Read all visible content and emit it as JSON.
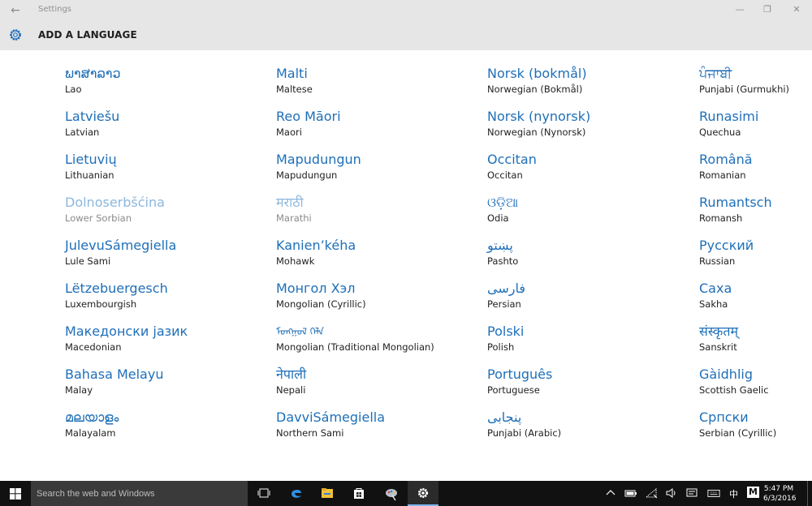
{
  "window": {
    "title": "Settings",
    "back_glyph": "←",
    "minimize_glyph": "—",
    "restore_glyph": "❐",
    "close_glyph": "✕"
  },
  "header": {
    "title": "ADD A LANGUAGE",
    "icon": "gear-icon"
  },
  "languages": {
    "columns": [
      [
        {
          "native": "ພາສາລາວ",
          "english": "Lao"
        },
        {
          "native": "Latviešu",
          "english": "Latvian"
        },
        {
          "native": "Lietuvių",
          "english": "Lithuanian"
        },
        {
          "native": "Dolnoserbšćina",
          "english": "Lower Sorbian"
        },
        {
          "native": "JulevuSámegiella",
          "english": "Lule Sami"
        },
        {
          "native": "Lëtzebuergesch",
          "english": "Luxembourgish"
        },
        {
          "native": "Македонски јазик",
          "english": "Macedonian"
        },
        {
          "native": "Bahasa Melayu",
          "english": "Malay"
        },
        {
          "native": "മലയാളം",
          "english": "Malayalam"
        }
      ],
      [
        {
          "native": "Malti",
          "english": "Maltese"
        },
        {
          "native": "Reo Māori",
          "english": "Maori"
        },
        {
          "native": "Mapudungun",
          "english": "Mapudungun"
        },
        {
          "native": "मराठी",
          "english": "Marathi"
        },
        {
          "native": "Kanien’kéha",
          "english": "Mohawk"
        },
        {
          "native": "Монгол Хэл",
          "english": "Mongolian (Cyrillic)"
        },
        {
          "native": "ᠮᠣᠩᠭᠣᠯ ᠬᠡᠯᠡ",
          "english": "Mongolian (Traditional Mongolian)"
        },
        {
          "native": "नेपाली",
          "english": "Nepali"
        },
        {
          "native": "DavviSámegiella",
          "english": "Northern Sami"
        }
      ],
      [
        {
          "native": "Norsk (bokmål)",
          "english": "Norwegian (Bokmål)"
        },
        {
          "native": "Norsk (nynorsk)",
          "english": "Norwegian (Nynorsk)"
        },
        {
          "native": "Occitan",
          "english": "Occitan"
        },
        {
          "native": "ଓଡ଼ିଆ",
          "english": "Odia"
        },
        {
          "native": "پښتو",
          "english": "Pashto"
        },
        {
          "native": "فارسی",
          "english": "Persian"
        },
        {
          "native": "Polski",
          "english": "Polish"
        },
        {
          "native": "Português",
          "english": "Portuguese"
        },
        {
          "native": "پنجابی",
          "english": "Punjabi (Arabic)"
        }
      ],
      [
        {
          "native": "ਪੰਜਾਬੀ",
          "english": "Punjabi (Gurmukhi)"
        },
        {
          "native": "Runasimi",
          "english": "Quechua"
        },
        {
          "native": "Română",
          "english": "Romanian"
        },
        {
          "native": "Rumantsch",
          "english": "Romansh"
        },
        {
          "native": "Русский",
          "english": "Russian"
        },
        {
          "native": "Саха",
          "english": "Sakha"
        },
        {
          "native": "संस्कृतम्",
          "english": "Sanskrit"
        },
        {
          "native": "Gàidhlig",
          "english": "Scottish Gaelic"
        },
        {
          "native": "Српски",
          "english": "Serbian (Cyrillic)"
        }
      ]
    ]
  },
  "taskbar": {
    "search_placeholder": "Search the web and Windows",
    "pinned": [
      "task-view-icon",
      "edge-icon",
      "file-explorer-icon",
      "store-icon",
      "paint-icon",
      "settings-icon"
    ],
    "ime_label": "中",
    "ime_mode": "M",
    "time": "5:47 PM",
    "date": "6/3/2016"
  },
  "colors": {
    "accent": "#1e6fb8",
    "disabled": "#8db7dd",
    "chrome": "#e6e6e6",
    "taskbar": "#111111"
  }
}
